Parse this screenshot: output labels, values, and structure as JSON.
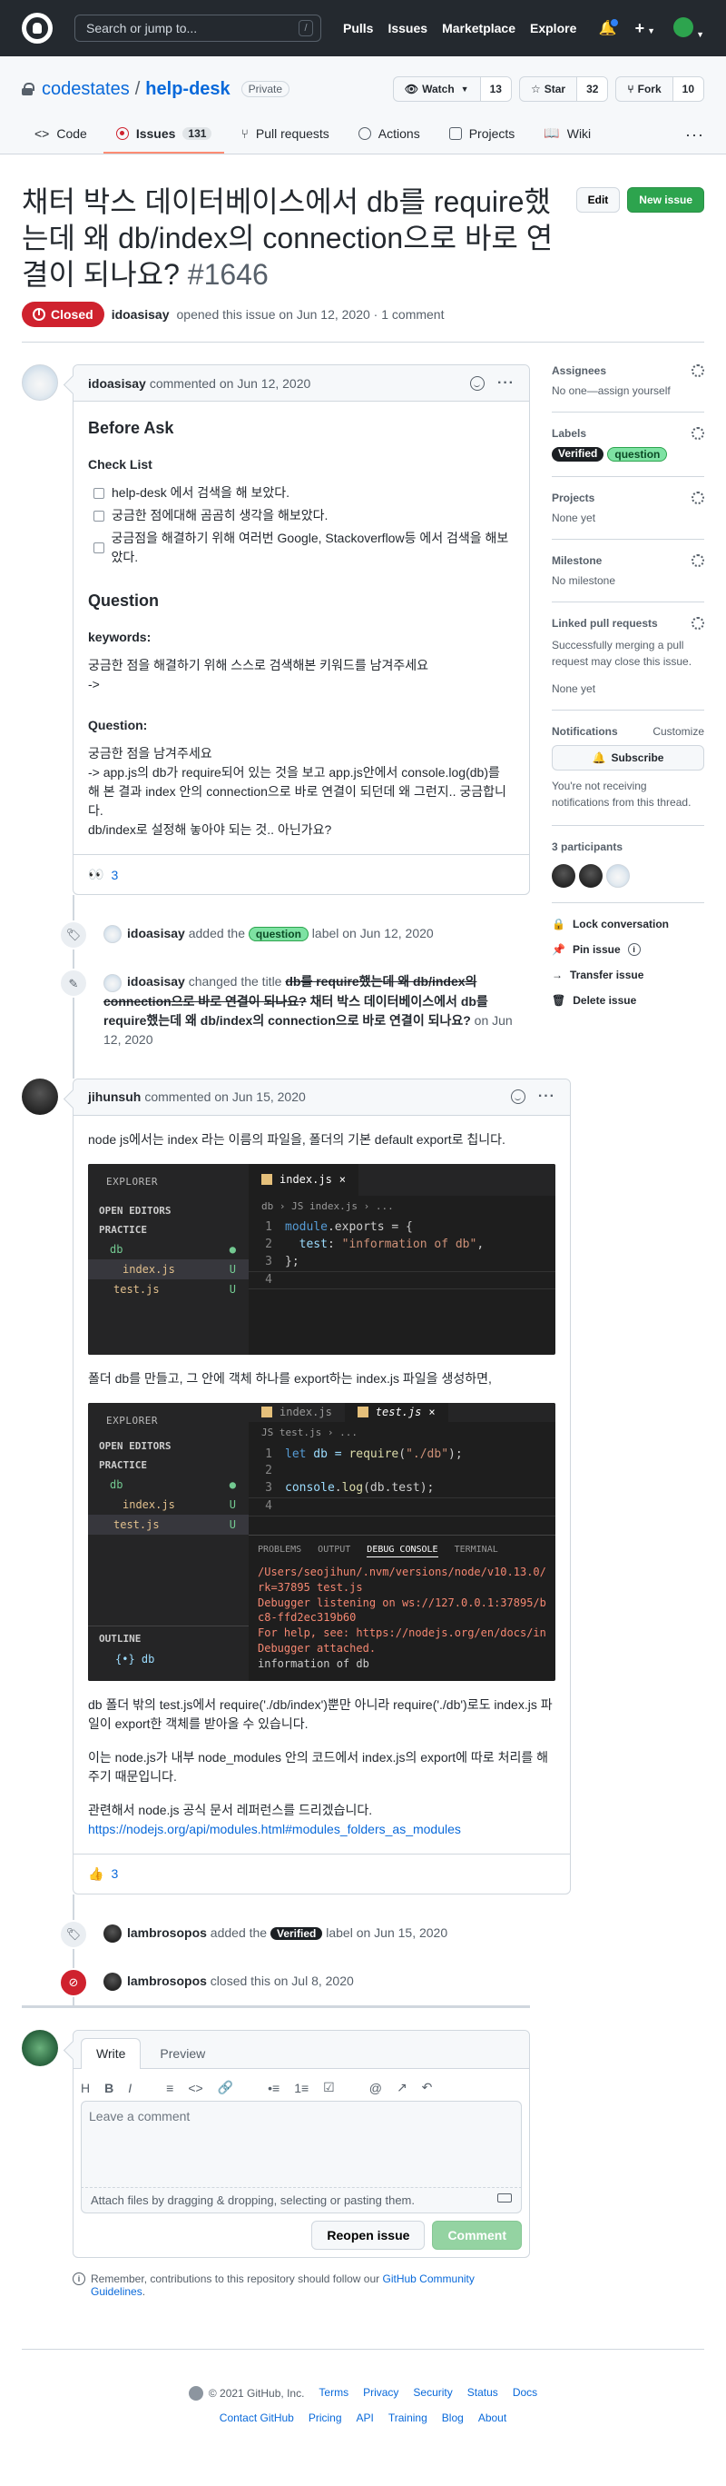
{
  "header": {
    "search_placeholder": "Search or jump to...",
    "search_key": "/",
    "nav": [
      "Pulls",
      "Issues",
      "Marketplace",
      "Explore"
    ],
    "plus": "+"
  },
  "repo": {
    "owner": "codestates",
    "separator": "/",
    "name": "help-desk",
    "visibility": "Private",
    "watch_label": "Watch",
    "watch_count": "13",
    "star_label": "Star",
    "star_count": "32",
    "fork_label": "Fork",
    "fork_count": "10",
    "tabs": [
      {
        "label": "Code"
      },
      {
        "label": "Issues",
        "count": "131"
      },
      {
        "label": "Pull requests"
      },
      {
        "label": "Actions"
      },
      {
        "label": "Projects"
      },
      {
        "label": "Wiki"
      }
    ],
    "more": "···"
  },
  "issue": {
    "title": "채터 박스 데이터베이스에서 db를 require했는데 왜 db/index의 connection으로 바로 연결이 되나요?",
    "number": "#1646",
    "edit_label": "Edit",
    "new_issue_label": "New issue",
    "state": "Closed",
    "author": "idoasisay",
    "opened_text": "opened this issue on Jun 12, 2020 · 1 comment"
  },
  "comment1": {
    "author": "idoasisay",
    "meta": "commented on Jun 12, 2020",
    "h_before": "Before Ask",
    "h_check": "Check List",
    "tasks": [
      "help-desk 에서 검색을 해 보았다.",
      "궁금한 점에대해 곰곰히 생각을 해보았다.",
      "궁금점을 해결하기 위해 여러번 Google, Stackoverflow등 에서 검색을 해보았다."
    ],
    "h_question": "Question",
    "h_keywords": "keywords:",
    "keywords_1": "궁금한 점을 해결하기 위해 스스로 검색해본 키워드를 남겨주세요",
    "keywords_2": "->",
    "h_question2": "Question:",
    "question_1": "궁금한 점을 남겨주세요",
    "question_2": "-> app.js의 db가 require되어 있는 것을 보고 app.js안에서 console.log(db)를 해 본 결과 index 안의 connection으로 바로 연결이 되던데 왜 그런지.. 궁금합니다.",
    "question_3": "db/index로 설정해 놓아야 되는 것.. 아닌가요?",
    "reaction_emoji": "👀",
    "reaction_count": "3"
  },
  "event_label": {
    "author": "idoasisay",
    "before": "added the",
    "label": "question",
    "after": "label on Jun 12, 2020"
  },
  "event_rename": {
    "author": "idoasisay",
    "before": "changed the title",
    "old_title": "db를 require했는데 왜 db/index의 connection으로 바로 연결이 되나요?",
    "new_title": "채터 박스 데이터베이스에서 db를 require했는데 왜 db/index의 connection으로 바로 연결이 되나요?",
    "after": "on Jun 12, 2020"
  },
  "comment2": {
    "author": "jihunsuh",
    "meta": "commented on Jun 15, 2020",
    "p1": "node js에서는 index 라는 이름의 파일을, 폴더의 기본 default export로 칩니다.",
    "p2": "폴더 db를 만들고, 그 안에 객체 하나를 export하는 index.js 파일을 생성하면,",
    "p3": "db 폴더 밖의 test.js에서 require('./db/index')뿐만 아니라 require('./db')로도 index.js 파일이 export한 객체를 받아올 수 있습니다.",
    "p4": "이는 node.js가 내부 node_modules 안의 코드에서 index.js의 export에 따로 처리를 해주기 때문입니다.",
    "p5": "관련해서 node.js 공식 문서 레퍼런스를 드리겠습니다.",
    "link": "https://nodejs.org/api/modules.html#modules_folders_as_modules",
    "reaction_emoji": "👍",
    "reaction_count": "3"
  },
  "shot1": {
    "explorer": "EXPLORER",
    "open_editors": "OPEN EDITORS",
    "project": "PRACTICE",
    "folder": "db",
    "file1": "index.js",
    "file2": "test.js",
    "u": "U",
    "tab": "index.js",
    "close": "×",
    "crumb": "db › JS index.js › ...",
    "l1": "1",
    "l2": "2",
    "l3": "3",
    "l4": "4",
    "c1a": "module",
    "c1b": ".exports = {",
    "c2a": "test",
    "c2b": ": ",
    "c2c": "\"information of db\"",
    "c2d": ",",
    "c3": "};"
  },
  "shot2": {
    "explorer": "EXPLORER",
    "open_editors": "OPEN EDITORS",
    "project": "PRACTICE",
    "folder": "db",
    "file1": "index.js",
    "file2": "test.js",
    "u": "U",
    "outline": "OUTLINE",
    "outline_item": "{•} db",
    "tab1": "index.js",
    "tab2": "test.js",
    "close": "×",
    "crumb": "JS test.js › ...",
    "l1": "1",
    "l2": "2",
    "l3": "3",
    "l4": "4",
    "c1a": "let",
    "c1b": " db = ",
    "c1c": "require",
    "c1d": "(",
    "c1e": "\"./db\"",
    "c1f": ");",
    "c3a": "console",
    "c3b": ".",
    "c3c": "log",
    "c3d": "(db.test);",
    "panel_tabs": [
      "PROBLEMS",
      "OUTPUT",
      "DEBUG CONSOLE",
      "TERMINAL"
    ],
    "out1": "/Users/seojihun/.nvm/versions/node/v10.13.0/",
    "out2": "rk=37895 test.js",
    "out3": "Debugger listening on ws://127.0.0.1:37895/b",
    "out4": "c8-ffd2ec319b60",
    "out5": "For help, see: https://nodejs.org/en/docs/in",
    "out6": "Debugger attached.",
    "out7": "information of db"
  },
  "event_verified": {
    "author": "lambrosopos",
    "before": "added the",
    "label": "Verified",
    "after": "label on Jun 15, 2020"
  },
  "event_closed": {
    "author": "lambrosopos",
    "text": "closed this on Jul 8, 2020"
  },
  "form": {
    "tab_write": "Write",
    "tab_preview": "Preview",
    "toolbar": [
      "H",
      "B",
      "I",
      "≡",
      "<>",
      "🔗",
      "•≡",
      "1≡",
      "☑",
      "@",
      "↗",
      "↶"
    ],
    "placeholder": "Leave a comment",
    "attach": "Attach files by dragging & dropping, selecting or pasting them.",
    "reopen": "Reopen issue",
    "comment": "Comment",
    "remember_1": "Remember, contributions to this repository should follow our",
    "remember_link": "GitHub Community Guidelines",
    "remember_2": "."
  },
  "sidebar": {
    "assignees_title": "Assignees",
    "assignees_value": "No one—assign yourself",
    "labels_title": "Labels",
    "label_a": "Verified",
    "label_b": "question",
    "projects_title": "Projects",
    "projects_value": "None yet",
    "milestone_title": "Milestone",
    "milestone_value": "No milestone",
    "linked_title": "Linked pull requests",
    "linked_desc": "Successfully merging a pull request may close this issue.",
    "linked_value": "None yet",
    "notif_title": "Notifications",
    "notif_customize": "Customize",
    "subscribe": "Subscribe",
    "notif_desc": "You're not receiving notifications from this thread.",
    "participants": "3 participants",
    "lock": "Lock conversation",
    "pin": "Pin issue",
    "transfer": "Transfer issue",
    "delete": "Delete issue"
  },
  "footer": {
    "copyright": "© 2021 GitHub, Inc.",
    "row1": [
      "Terms",
      "Privacy",
      "Security",
      "Status",
      "Docs"
    ],
    "row2": [
      "Contact GitHub",
      "Pricing",
      "API",
      "Training",
      "Blog",
      "About"
    ]
  }
}
